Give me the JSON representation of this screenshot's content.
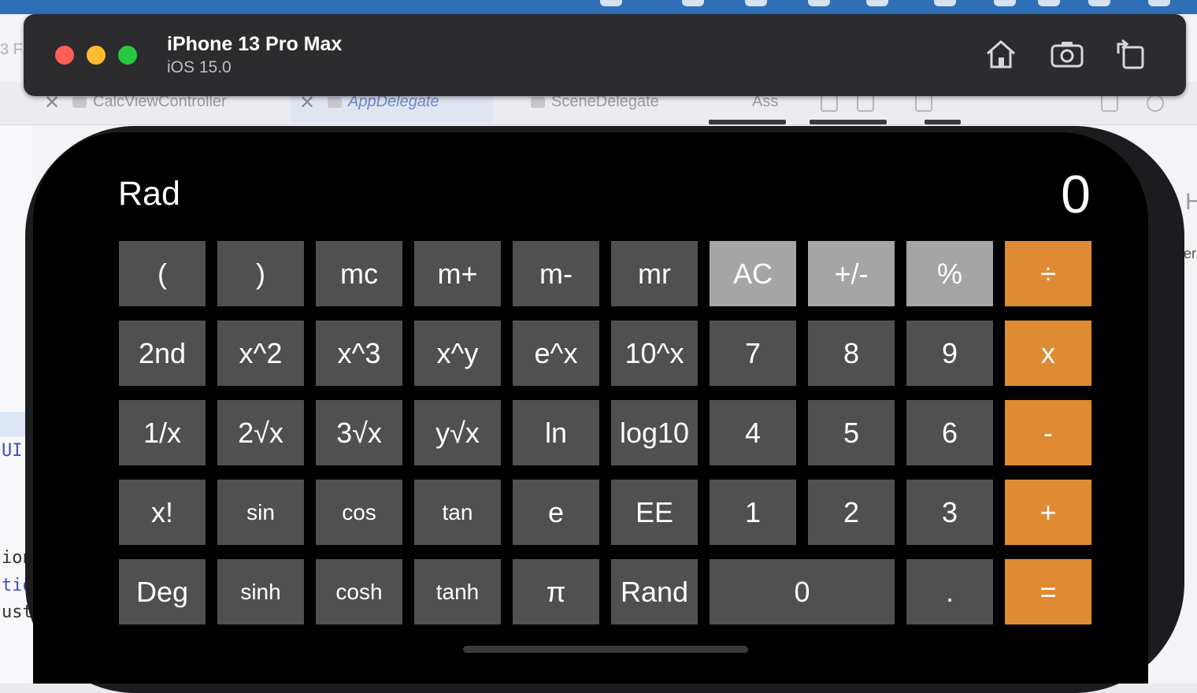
{
  "simulator": {
    "device_name": "iPhone 13 Pro Max",
    "os_version": "iOS 15.0",
    "buttons": [
      "home-icon",
      "screenshot-icon",
      "rotate-icon"
    ]
  },
  "xcode": {
    "tabs": [
      "CalcViewController",
      "AppDelegate",
      "SceneDelegate"
    ],
    "tab_partial": "Ass",
    "tab_left_partial": "3 F",
    "code_fragments": [
      "UI",
      "ion",
      "tio",
      "ust"
    ],
    "right_fragments": [
      "H",
      "er"
    ]
  },
  "calculator": {
    "mode": "Rad",
    "display": "0",
    "rows": [
      [
        "(",
        ")",
        "mc",
        "m+",
        "m-",
        "mr",
        "AC",
        "+/-",
        "%",
        "÷"
      ],
      [
        "2nd",
        "x^2",
        "x^3",
        "x^y",
        "e^x",
        "10^x",
        "7",
        "8",
        "9",
        "x"
      ],
      [
        "1/x",
        "2√x",
        "3√x",
        "y√x",
        "ln",
        "log10",
        "4",
        "5",
        "6",
        "-"
      ],
      [
        "x!",
        "sin",
        "cos",
        "tan",
        "e",
        "EE",
        "1",
        "2",
        "3",
        "+"
      ],
      [
        "Deg",
        "sinh",
        "cosh",
        "tanh",
        "π",
        "Rand",
        "0",
        ".",
        "="
      ]
    ],
    "colors": {
      "function_key": "#505050",
      "utility_key": "#a5a5a5",
      "operator_key": "#df8b33",
      "background": "#000000"
    }
  }
}
